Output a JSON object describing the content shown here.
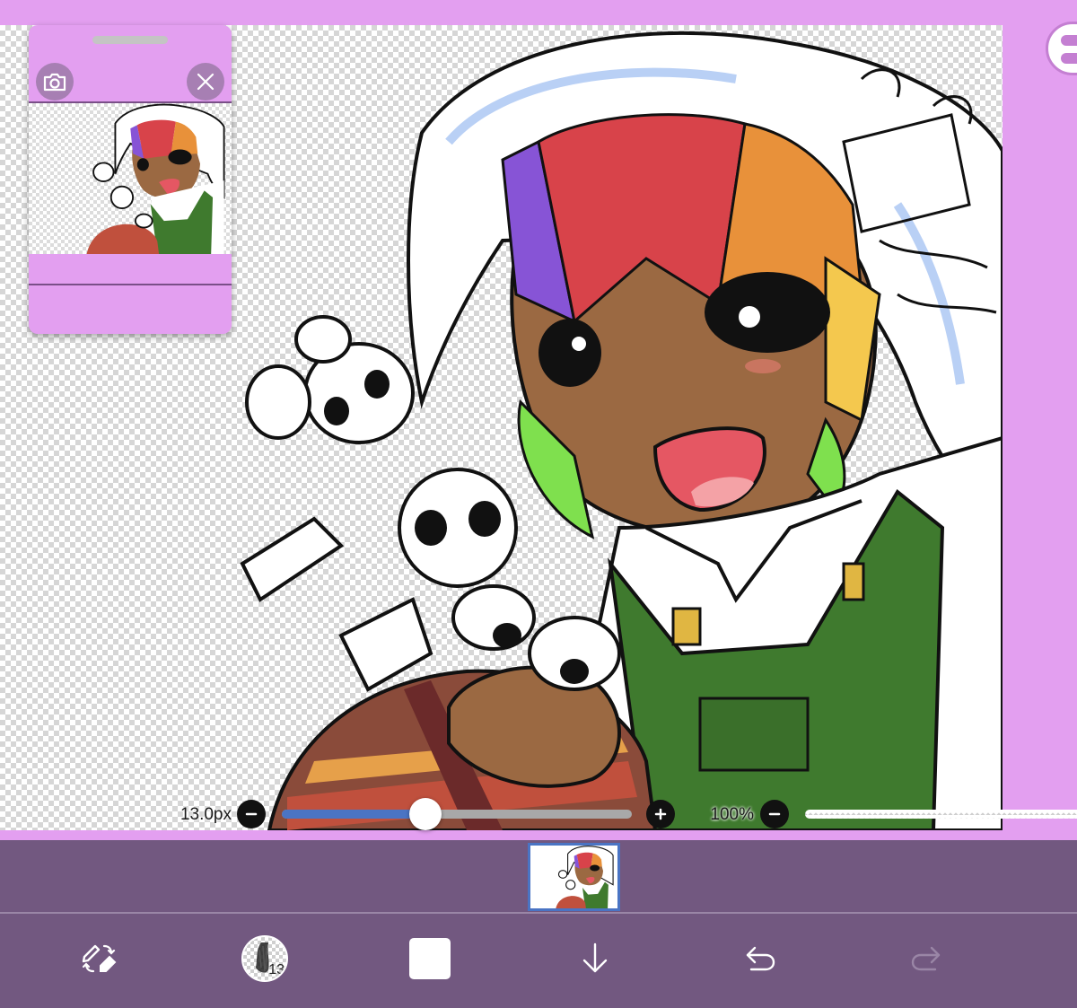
{
  "app": {
    "accent": "#e39ff0",
    "toolbar_bg": "#725880",
    "slider_accent": "#4a74c4"
  },
  "reference_window": {
    "camera_icon": "camera-icon",
    "close_icon": "close-icon"
  },
  "brush": {
    "size_label": "13.0px",
    "size_fraction": 0.41,
    "minus_icon": "minus-icon",
    "plus_icon": "plus-icon"
  },
  "opacity": {
    "label": "100%",
    "minus_icon": "minus-icon"
  },
  "toolbar": {
    "transform_tool_icon": "pen-eraser-swap-icon",
    "brush_size_badge": "13",
    "color_swatch": "#ffffff",
    "down_arrow_icon": "arrow-down-icon",
    "undo_icon": "undo-icon",
    "redo_icon": "redo-icon"
  }
}
